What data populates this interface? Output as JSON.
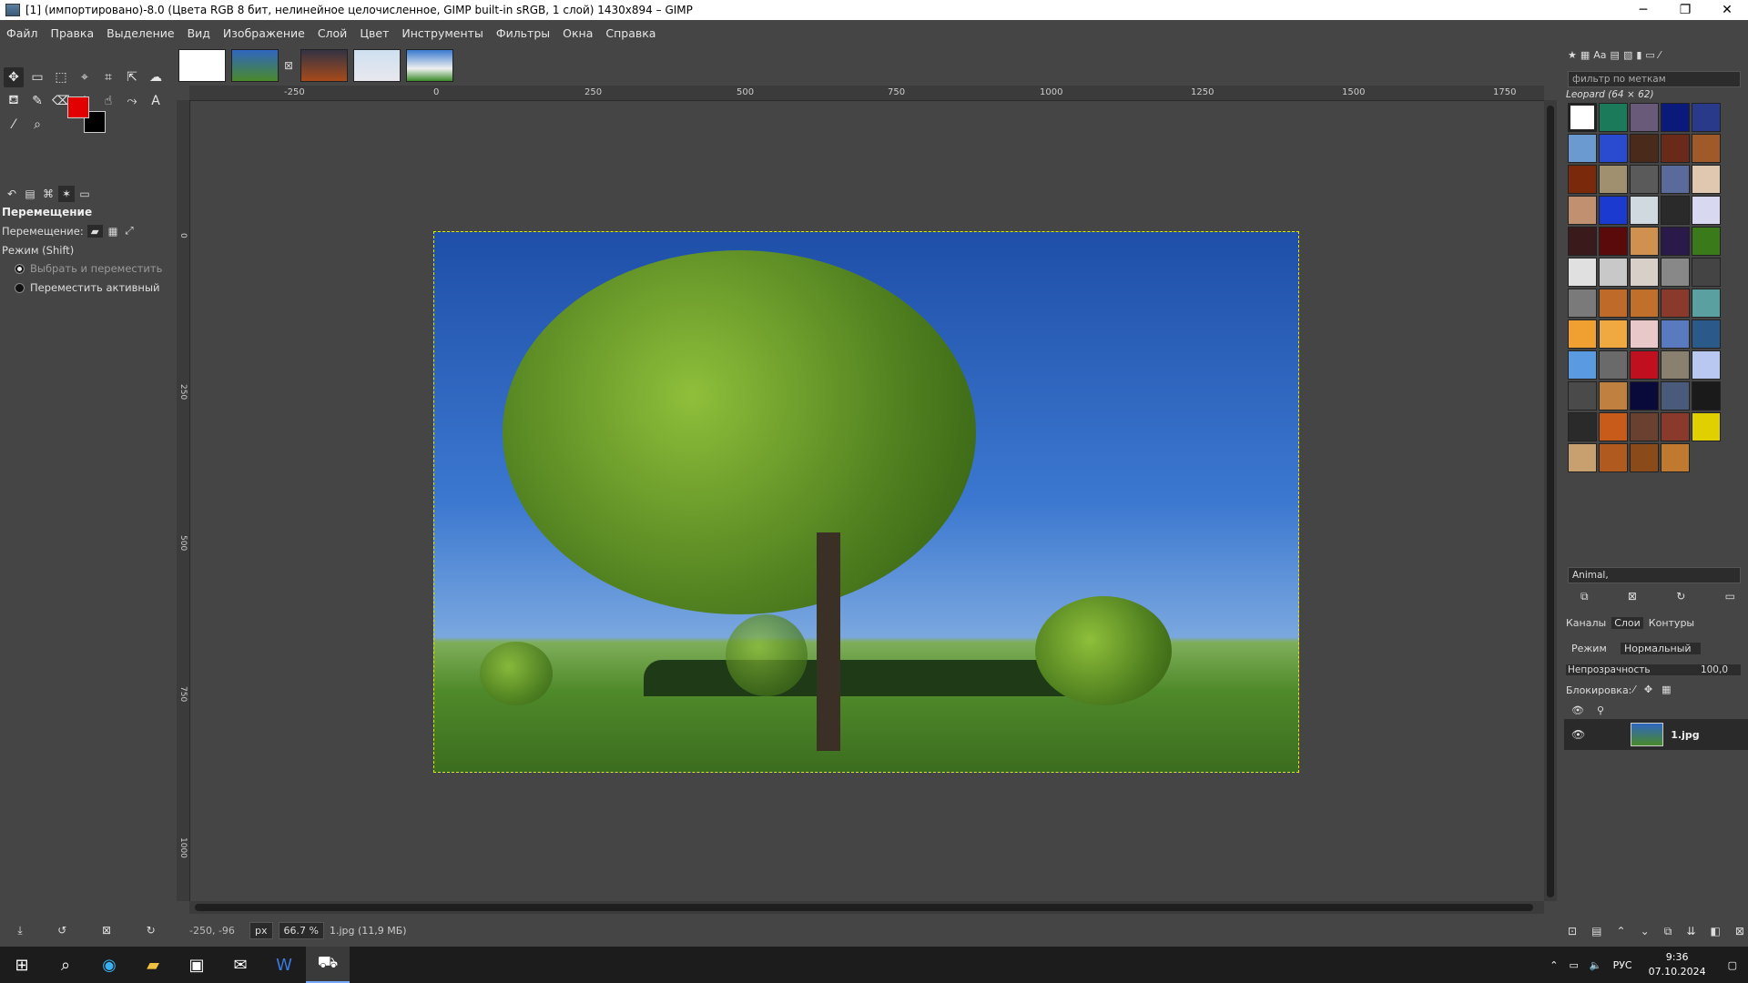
{
  "window": {
    "title": "[1] (импортировано)-8.0 (Цвета RGB 8 бит, нелинейное целочисленное, GIMP built-in sRGB, 1 слой) 1430x894 – GIMP",
    "minimize": "─",
    "maximize": "❐",
    "close": "✕"
  },
  "menu": [
    "Файл",
    "Правка",
    "Выделение",
    "Вид",
    "Изображение",
    "Слой",
    "Цвет",
    "Инструменты",
    "Фильтры",
    "Окна",
    "Справка"
  ],
  "tool_options": {
    "title": "Перемещение",
    "move_label": "Перемещение:",
    "mode_label": "Режим (Shift)",
    "option1": "Выбрать и переместить",
    "option2": "Переместить активный"
  },
  "colors": {
    "foreground": "#e30000",
    "background": "#000000"
  },
  "rulers": {
    "h": [
      "-250",
      "0",
      "250",
      "500",
      "750",
      "1000",
      "1250",
      "1500",
      "1750"
    ],
    "v": [
      "0",
      "250",
      "500",
      "750",
      "1000"
    ]
  },
  "status": {
    "coords": "-250, -96",
    "unit": "px",
    "zoom": "66.7 %",
    "file": "1.jpg (11,9 МБ)"
  },
  "patterns": {
    "filter_placeholder": "фильтр по меткам",
    "selected": "Leopard (64 × 62)",
    "tag": "Animal,"
  },
  "layers": {
    "tabs": [
      "Каналы",
      "Слои",
      "Контуры"
    ],
    "mode_label": "Режим",
    "mode_value": "Нормальный",
    "opacity_label": "Непрозрачность",
    "opacity_value": "100,0",
    "lock_label": "Блокировка:",
    "layer_name": "1.jpg"
  },
  "taskbar": {
    "lang": "РУС",
    "time": "9:36",
    "date": "07.10.2024"
  }
}
